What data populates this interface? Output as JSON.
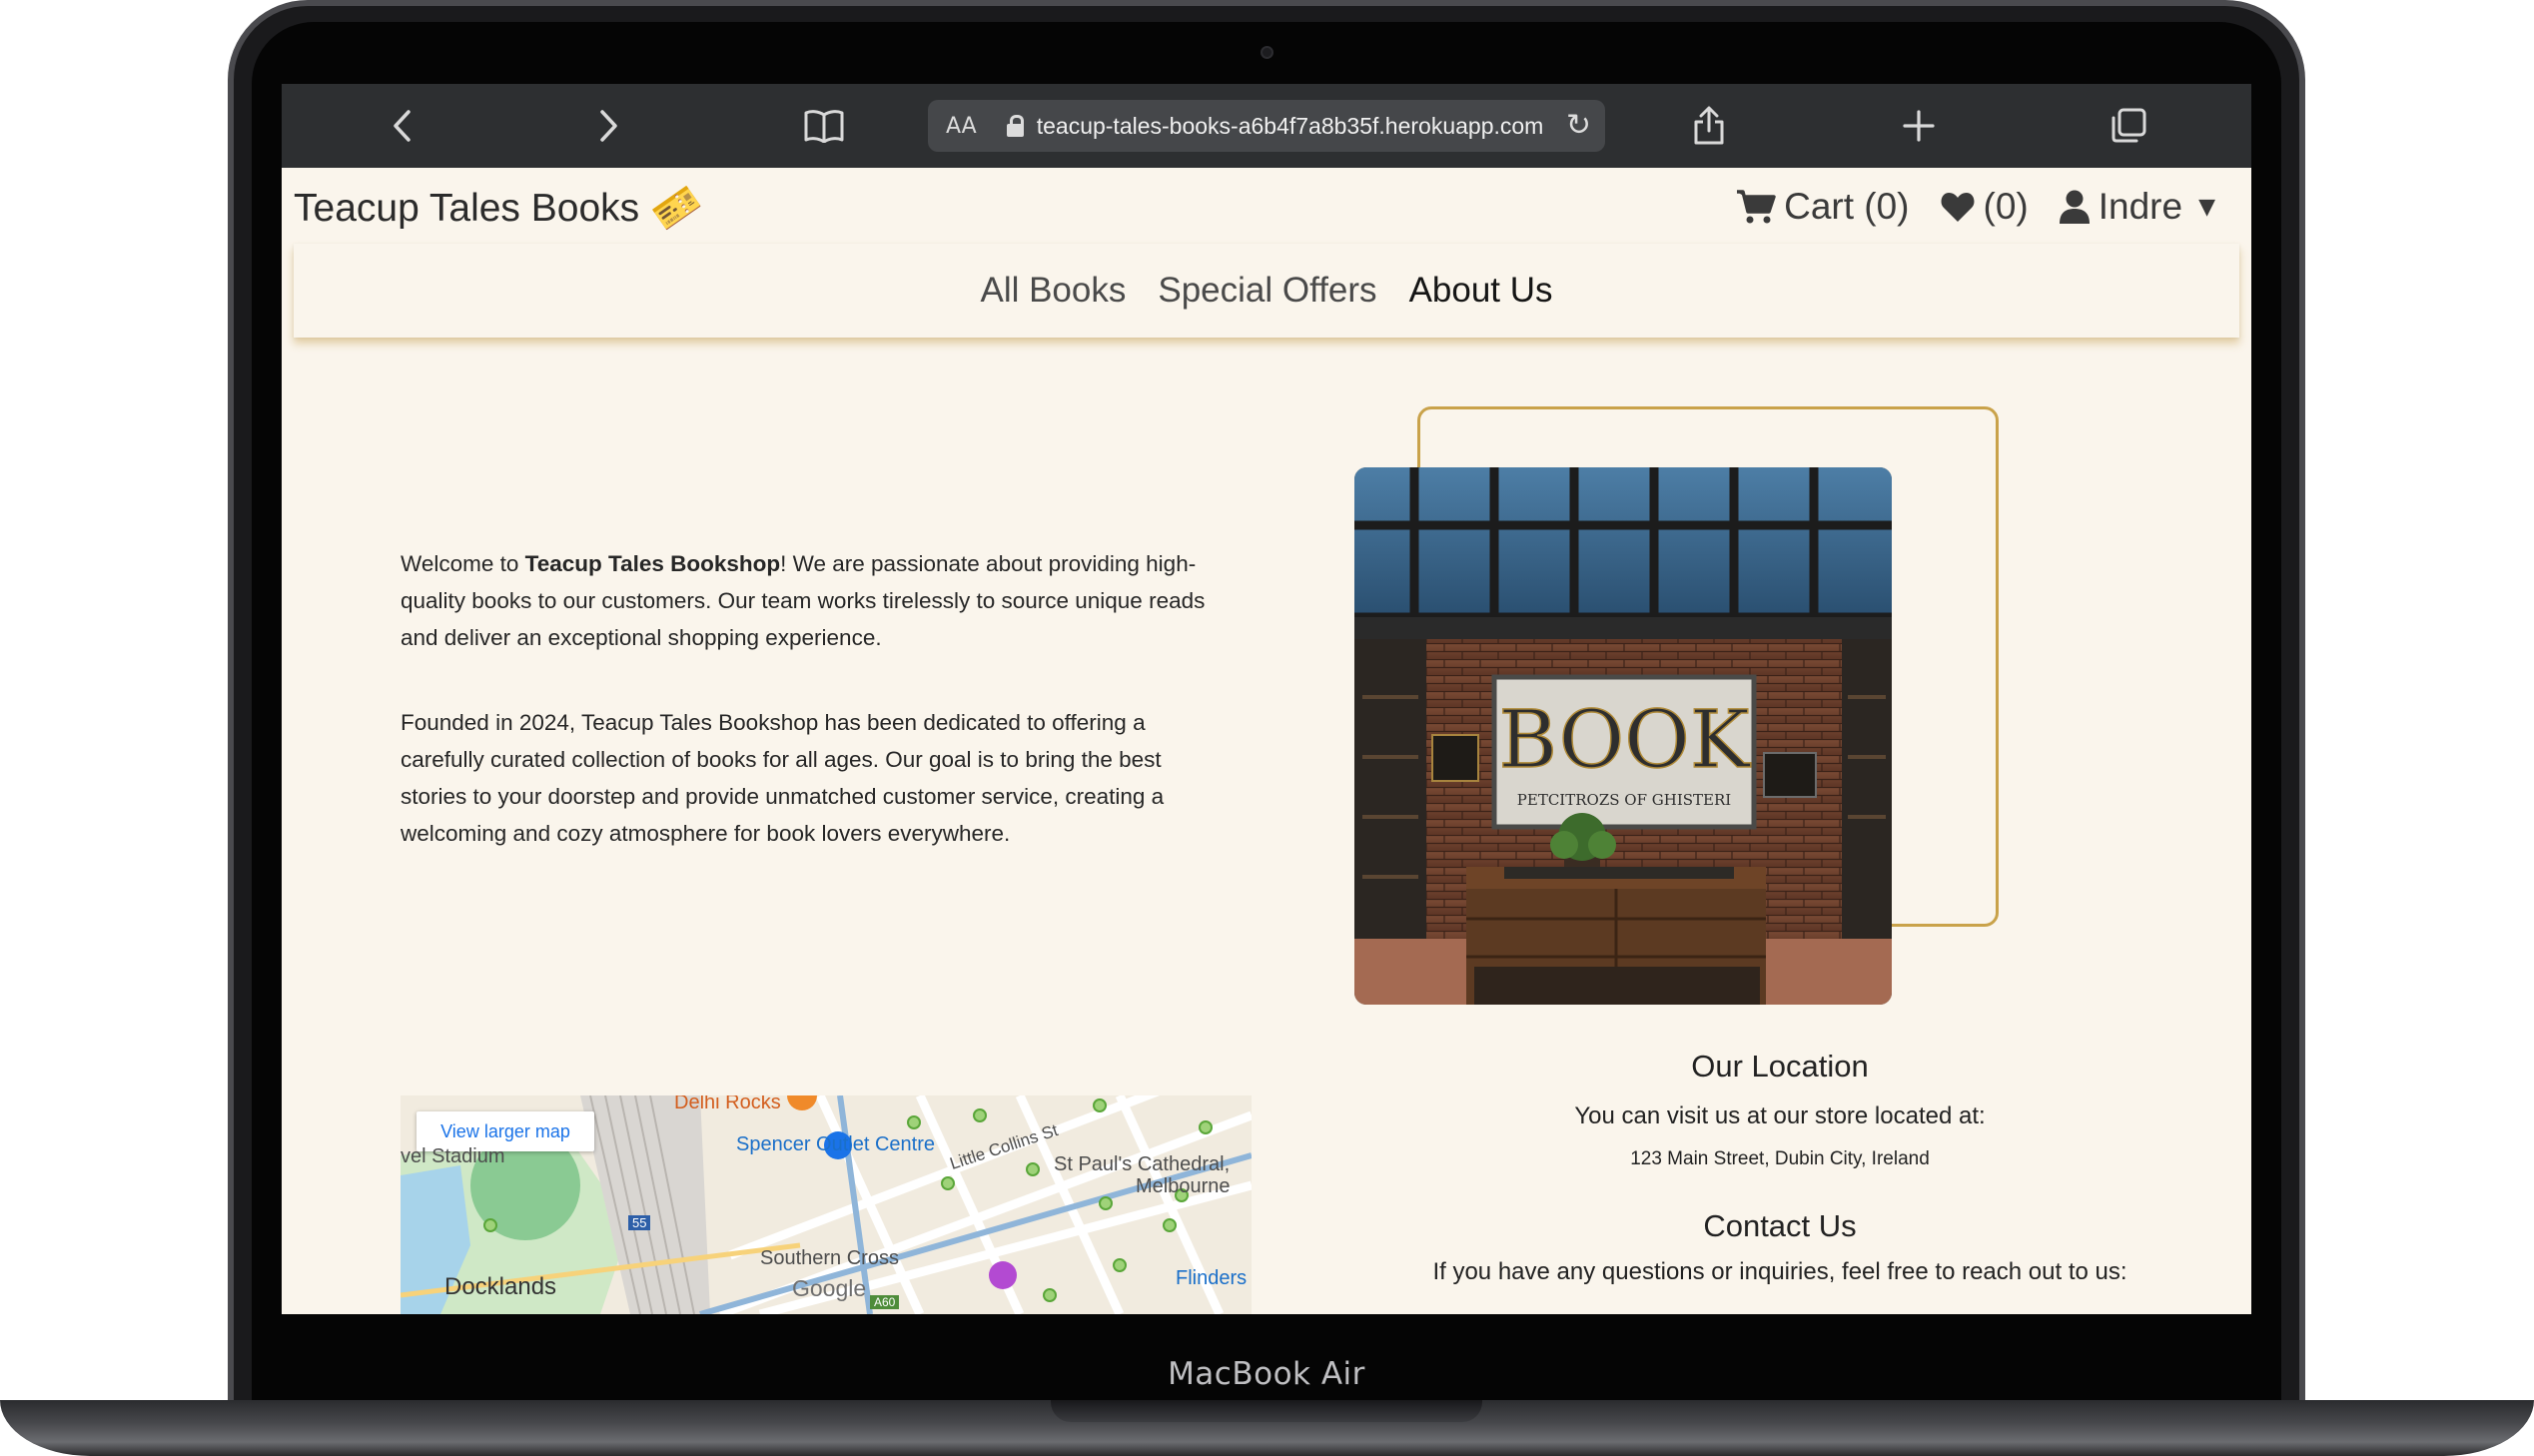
{
  "device": {
    "label": "MacBook Air"
  },
  "browser": {
    "text_size_label": "AA",
    "url": "teacup-tales-books-a6b4f7a8b35f.herokuapp.com",
    "icons": [
      "chevron-left-icon",
      "chevron-right-icon",
      "bookmarks-icon",
      "lock-icon",
      "reload-icon",
      "share-icon",
      "plus-icon",
      "tabs-icon"
    ]
  },
  "site": {
    "brand": "Teacup Tales Books",
    "brand_icon": "ticket-icon",
    "cart": "Cart (0)",
    "wishlist": "(0)",
    "user": "Indre",
    "nav": [
      "All Books",
      "Special Offers",
      "About Us"
    ],
    "active_nav": "About Us",
    "colors": {
      "accent": "#c9a24a",
      "background": "#faf5ec",
      "brand_icon": "#d93a2e"
    }
  },
  "about": {
    "p1_before": "Welcome to ",
    "p1_bold": "Teacup Tales Bookshop",
    "p1_after": "! We are passionate about providing high-quality books to our customers. Our team works tirelessly to source unique reads and deliver an exceptional shopping experience.",
    "p2": "Founded in 2024, Teacup Tales Bookshop has been dedicated to offering a carefully curated collection of books for all ages. Our goal is to bring the best stories to your doorstep and provide unmatched customer service, creating a welcoming and cozy atmosphere for book lovers everywhere."
  },
  "photo": {
    "sign_title": "BOOK",
    "sign_subtitle": "PETCITROZS OF GHISTERI"
  },
  "location": {
    "heading": "Our Location",
    "line": "You can visit us at our store located at:",
    "address": "123 Main Street, Dubin City, Ireland"
  },
  "contact": {
    "heading": "Contact Us",
    "line": "If you have any questions or inquiries, feel free to reach out to us:"
  },
  "map": {
    "link": "View larger map",
    "labels": {
      "delhi": "Delhi Rocks",
      "spencer": "Spencer Outlet Centre",
      "collins": "Little Collins St",
      "stpauls": "St Paul's Cathedral,",
      "melbourne": "Melbourne",
      "stadium": "vel Stadium",
      "southern": "Southern Cross",
      "docklands": "Docklands",
      "flinders": "Flinders",
      "google": "Google",
      "road_a60": "A60",
      "road_55": "55"
    }
  }
}
